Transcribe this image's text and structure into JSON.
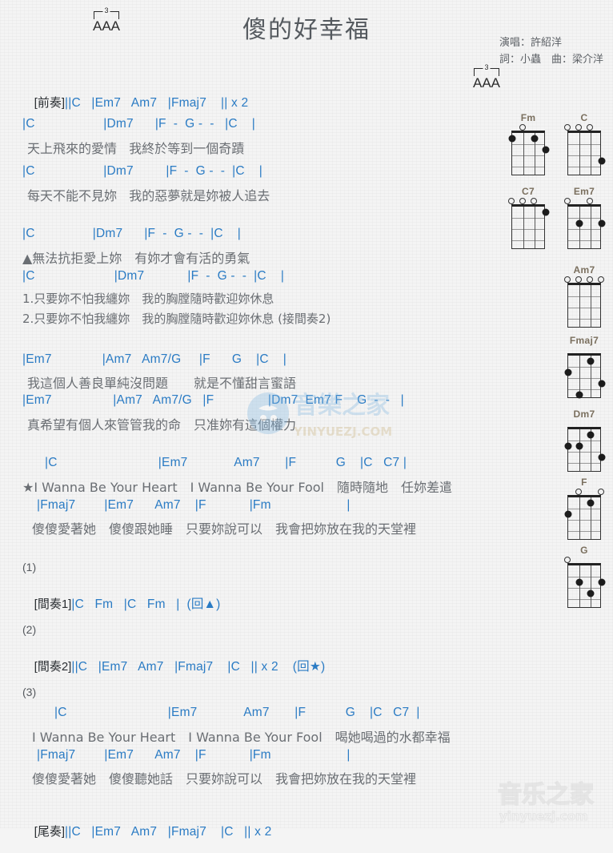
{
  "header": {
    "title": "傻的好幸福",
    "singer_line": "演唱：許紹洋",
    "writer_line": "詞：小蟲　曲：梁介洋",
    "strum_pattern": "AAA",
    "strum_tuplet": "3"
  },
  "intro": {
    "label": "[前奏]",
    "chords": "||C   |Em7   Am7   |Fmaj7    || x 2"
  },
  "verses": [
    {
      "chords": "|C                   |Dm7      |F  -  G -  -   |C    |",
      "lyric": "天上飛來的愛情   我終於等到一個奇蹟"
    },
    {
      "chords": "|C                   |Dm7         |F  -  G -  -  |C    |",
      "lyric": "每天不能不見妳   我的惡夢就是妳被人追去"
    }
  ],
  "section_a": {
    "chords": "|C                |Dm7      |F  -  G -  -  |C    |",
    "lyric": "▲無法抗拒愛上妳　有妳才會有活的勇氣",
    "chords2": "|C                      |Dm7            |F  -  G -  -  |C    |",
    "lyric1": "1.只要妳不怕我纏妳　我的胸膛隨時歡迎妳休息",
    "lyric2": "2.只要妳不怕我纏妳　我的胸膛隨時歡迎妳休息 (接間奏2)"
  },
  "bridge": [
    {
      "chords": "|Em7              |Am7   Am7/G     |F      G    |C    |",
      "lyric": "我這個人善良單純沒問題　　就是不懂甜言蜜語"
    },
    {
      "chords": "|Em7                 |Am7   Am7/G   |F               |Dm7  Em7 F    G  -  -   |",
      "lyric": "真希望有個人來管管我的命　只准妳有這個權力"
    }
  ],
  "chorus": {
    "chords1": "|C                            |Em7             Am7       |F           G    |C   C7 |",
    "lyric1": "★I Wanna Be Your Heart　I Wanna Be Your Fool　隨時隨地　任妳差遣",
    "chords2": "|Fmaj7        |Em7      Am7    |F            |Fm                     |",
    "lyric2": "傻傻愛著她　傻傻跟她睡　只要妳說可以　我會把妳放在我的天堂裡"
  },
  "interlude1": {
    "number": "(1)",
    "label": "[間奏1]",
    "chords": "|C   Fm   |C   Fm   |  (回▲)"
  },
  "interlude2": {
    "number": "(2)",
    "label": "[間奏2]",
    "chords": "||C   |Em7   Am7   |Fmaj7    |C   || x 2    (回★)"
  },
  "final_chorus": {
    "number": "(3)",
    "chords1": "|C                            |Em7             Am7       |F           G    |C   C7  |",
    "lyric1": "I Wanna Be Your Heart　I Wanna Be Your Fool　喝她喝過的水都幸福",
    "chords2": "|Fmaj7        |Em7      Am7    |F            |Fm                     |",
    "lyric2": "傻傻愛著她　傻傻聽她話　只要妳說可以　我會把妳放在我的天堂裡"
  },
  "outro": {
    "label": "[尾奏]",
    "chords": "||C   |Em7   Am7   |Fmaj7    |C   || x 2"
  },
  "colors": {
    "chord": "#2a7bc4",
    "barline": "#6b6128",
    "lyric": "#6a6e73",
    "title": "#555a5f",
    "diagram_label": "#7a6f5e",
    "watermark": "#7fb6e0"
  },
  "chord_diagrams": [
    {
      "name": "Fm",
      "opens": [
        2
      ],
      "dots": [
        {
          "string": 1,
          "fret": 1
        },
        {
          "string": 3,
          "fret": 1
        },
        {
          "string": 4,
          "fret": 2
        }
      ]
    },
    {
      "name": "C",
      "opens": [
        1,
        2,
        3
      ],
      "dots": [
        {
          "string": 4,
          "fret": 3
        }
      ]
    },
    {
      "name": "C7",
      "opens": [
        1,
        2,
        3
      ],
      "dots": [
        {
          "string": 4,
          "fret": 1
        }
      ]
    },
    {
      "name": "Em7",
      "opens": [
        1,
        3
      ],
      "dots": [
        {
          "string": 2,
          "fret": 2
        },
        {
          "string": 4,
          "fret": 2
        }
      ]
    },
    {
      "name": "Am7",
      "opens": [
        1,
        2,
        3,
        4
      ],
      "dots": []
    },
    {
      "name": "Fmaj7",
      "opens": [],
      "dots": [
        {
          "string": 3,
          "fret": 1
        },
        {
          "string": 1,
          "fret": 2
        },
        {
          "string": 4,
          "fret": 3
        },
        {
          "string": 2,
          "fret": 4
        }
      ]
    },
    {
      "name": "Dm7",
      "opens": [],
      "dots": [
        {
          "string": 3,
          "fret": 1
        },
        {
          "string": 1,
          "fret": 2
        },
        {
          "string": 2,
          "fret": 2
        },
        {
          "string": 4,
          "fret": 3
        }
      ]
    },
    {
      "name": "F",
      "opens": [
        2,
        4
      ],
      "dots": [
        {
          "string": 3,
          "fret": 1
        },
        {
          "string": 1,
          "fret": 2
        }
      ]
    },
    {
      "name": "G",
      "opens": [
        1
      ],
      "dots": [
        {
          "string": 2,
          "fret": 2
        },
        {
          "string": 4,
          "fret": 2
        },
        {
          "string": 3,
          "fret": 3
        }
      ]
    }
  ],
  "watermarks": {
    "center_cn": "音樂之家",
    "center_url": "YINYUEZJ.COM",
    "bottom_cn": "音乐之家",
    "bottom_url": "yinyuezj.com"
  }
}
